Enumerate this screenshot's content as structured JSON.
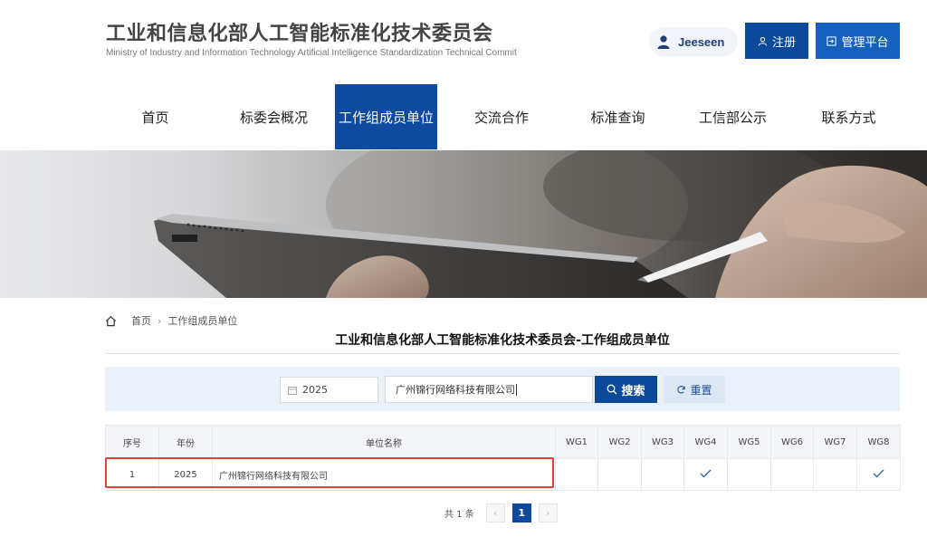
{
  "header": {
    "title": "工业和信息化部人工智能标准化技术委员会",
    "subtitle": "Ministry of Industry and Information Technology Artificial Intelligence Standardization Technical Commit",
    "username": "Jeeseen",
    "register_label": "注册",
    "admin_label": "管理平台"
  },
  "nav": {
    "items": [
      {
        "label": "首页"
      },
      {
        "label": "标委会概况"
      },
      {
        "label": "工作组成员单位"
      },
      {
        "label": "交流合作"
      },
      {
        "label": "标准查询"
      },
      {
        "label": "工信部公示"
      },
      {
        "label": "联系方式"
      }
    ],
    "active_index": 2
  },
  "breadcrumb": {
    "home": "首页",
    "current": "工作组成员单位"
  },
  "page_title": "工业和信息化部人工智能标准化技术委员会-工作组成员单位",
  "search": {
    "year_value": "2025",
    "name_value": "广州锦行网络科技有限公司",
    "search_label": "搜索",
    "reset_label": "重置"
  },
  "table": {
    "headers": [
      "序号",
      "年份",
      "单位名称",
      "WG1",
      "WG2",
      "WG3",
      "WG4",
      "WG5",
      "WG6",
      "WG7",
      "WG8"
    ],
    "rows": [
      {
        "index": "1",
        "year": "2025",
        "name": "广州锦行网络科技有限公司",
        "wg": [
          false,
          false,
          false,
          true,
          false,
          false,
          false,
          true
        ]
      }
    ]
  },
  "pagination": {
    "total_text": "共 1 条",
    "current_page": "1",
    "prev": "‹",
    "next": "›"
  },
  "colors": {
    "primary": "#0b4a9b",
    "highlight": "#e0413a"
  }
}
